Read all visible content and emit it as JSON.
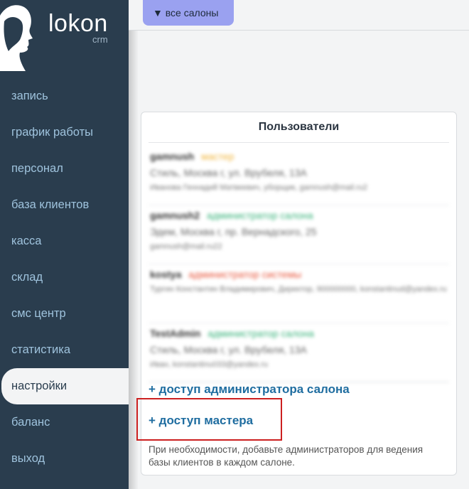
{
  "logo": {
    "name": "lokon",
    "sub": "crm"
  },
  "sidebar": {
    "items": [
      {
        "label": "запись"
      },
      {
        "label": "график работы"
      },
      {
        "label": "персонал"
      },
      {
        "label": "база клиентов"
      },
      {
        "label": "касса"
      },
      {
        "label": "склад"
      },
      {
        "label": "смс центр"
      },
      {
        "label": "статистика"
      },
      {
        "label": "настройки",
        "active": true
      },
      {
        "label": "баланс"
      },
      {
        "label": "выход"
      }
    ]
  },
  "topbar": {
    "salon_selector": "▼ все салоны"
  },
  "users_panel": {
    "title": "Пользователи",
    "users": [
      {
        "login": "gamnush",
        "role": "мастер",
        "role_color": "#f0b43a",
        "address": "Стиль, Москва г, ул. Врубеля, 13А",
        "info": "Иванова Геннадий Матвеевич, уборщик, gamnush@mail.ru2"
      },
      {
        "login": "gamnush2",
        "role": "администратор салона",
        "role_color": "#37b27a",
        "address": "Эдем, Москва г, пр. Вернадского, 25",
        "info": "gamnush@mail.ru22"
      },
      {
        "login": "kostya",
        "role": "администратор системы",
        "role_color": "#e8573d",
        "address": "",
        "info": "Тургин Константин Владимирович, Директор, 900000000, konstantinud@yandex.ru"
      },
      {
        "login": "TestAdmin",
        "role": "администратор салона",
        "role_color": "#37b27a",
        "address": "Стиль, Москва г, ул. Врубеля, 13А",
        "info": "Иван, konstantinu033@yandex.ru"
      }
    ],
    "add_admin_label": "+ доступ администратора салона",
    "add_master_label": "+ доступ мастера",
    "note": "При необходимости, добавьте администраторов для ведения базы клиентов в каждом салоне."
  },
  "colors": {
    "sidebar_bg": "#2a3d4e",
    "nav_text": "#9fc3dd",
    "accent_button": "#9aa1f0",
    "link": "#1f6da0",
    "highlight": "#cc2020"
  }
}
